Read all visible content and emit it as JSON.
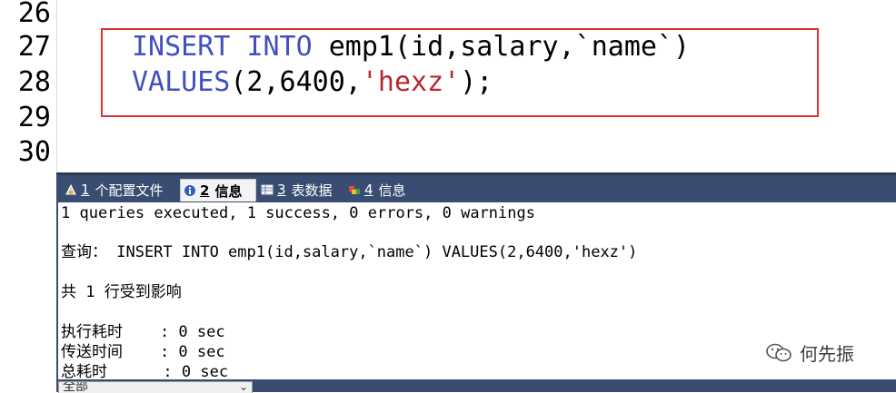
{
  "editor": {
    "line_numbers": [
      "26",
      "27",
      "28",
      "29",
      "30"
    ],
    "line27": {
      "kw1": "INSERT",
      "kw2": "INTO",
      "rest": "emp1(id,salary,`name`)"
    },
    "line28": {
      "kw": "VALUES",
      "open": "(2,6400,",
      "str": "'hexz'",
      "close": ");"
    },
    "colors": {
      "keyword": "#4150c0",
      "string": "#b8282a",
      "highlight_box": "#e03131"
    }
  },
  "tabs": [
    {
      "num": "1",
      "label": "个配置文件",
      "icon": "profile-icon"
    },
    {
      "num": "2",
      "label": "信息",
      "icon": "info-icon"
    },
    {
      "num": "3",
      "label": "表数据",
      "icon": "table-icon"
    },
    {
      "num": "4",
      "label": "信息",
      "icon": "info-icon"
    }
  ],
  "messages": {
    "summary": "1 queries executed, 1 success, 0 errors, 0 warnings",
    "query": "查询： INSERT INTO emp1(id,salary,`name`) VALUES(2,6400,'hexz')",
    "affected": "共 1 行受到影响",
    "exec_time": "执行耗时    : 0 sec",
    "transfer_time": "传送时间    : 0 sec",
    "total_time": "总耗时      : 0 sec"
  },
  "bottom": {
    "combo_label": "全部"
  },
  "watermark": {
    "text": "何先振",
    "icon": "wechat-icon"
  },
  "theme": {
    "tabbar_bg": "#394d72"
  }
}
